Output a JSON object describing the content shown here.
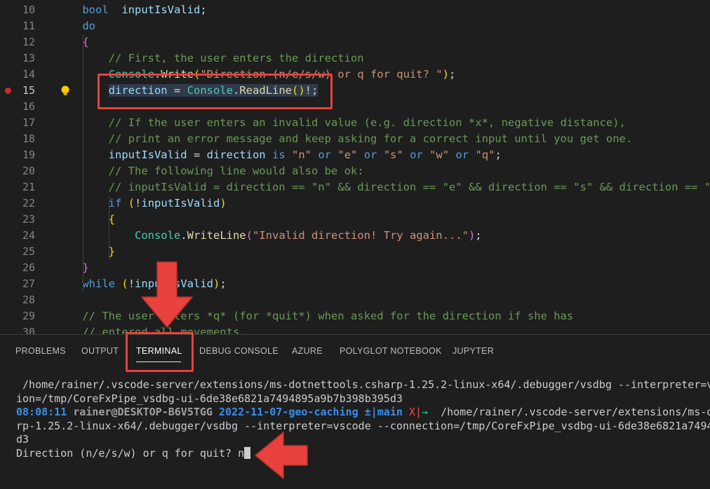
{
  "editor": {
    "lines": [
      {
        "n": "10",
        "parts": [
          [
            "kw",
            "bool"
          ],
          [
            "",
            "  "
          ],
          [
            "var",
            "inputIsValid"
          ],
          [
            "",
            ";"
          ]
        ],
        "indent": "    "
      },
      {
        "n": "11",
        "parts": [
          [
            "kw",
            "do"
          ]
        ],
        "indent": "    "
      },
      {
        "n": "12",
        "parts": [
          [
            "br2",
            "{"
          ]
        ],
        "indent": "    "
      },
      {
        "n": "13",
        "parts": [
          [
            "cmt",
            "// First, the user enters the direction"
          ]
        ],
        "indent": "        "
      },
      {
        "n": "14",
        "parts": [
          [
            "ty",
            "Console"
          ],
          [
            "",
            "."
          ],
          [
            "fn",
            "Write"
          ],
          [
            "br",
            "("
          ],
          [
            "str",
            "\"Direction (n/e/s/w) or q for quit? \""
          ],
          [
            "br",
            ")"
          ],
          [
            "",
            ";"
          ]
        ],
        "indent": "        "
      },
      {
        "n": "15",
        "parts": [
          [
            "var hl",
            "direction"
          ],
          [
            "hl",
            " = "
          ],
          [
            "ty hl",
            "Console"
          ],
          [
            "hl",
            "."
          ],
          [
            "fn hl",
            "ReadLine"
          ],
          [
            "br hl",
            "()"
          ],
          [
            "hl",
            "!;"
          ]
        ],
        "indent": "        "
      },
      {
        "n": "16",
        "parts": [],
        "indent": ""
      },
      {
        "n": "17",
        "parts": [
          [
            "cmt",
            "// If the user enters an invalid value (e.g. direction *x*, negative distance),"
          ]
        ],
        "indent": "        "
      },
      {
        "n": "18",
        "parts": [
          [
            "cmt",
            "// print an error message and keep asking for a correct input until you get one."
          ]
        ],
        "indent": "        "
      },
      {
        "n": "19",
        "parts": [
          [
            "var",
            "inputIsValid"
          ],
          [
            "",
            " = "
          ],
          [
            "var",
            "direction"
          ],
          [
            "",
            " "
          ],
          [
            "kw",
            "is"
          ],
          [
            "",
            " "
          ],
          [
            "str",
            "\"n\""
          ],
          [
            "",
            " "
          ],
          [
            "kw",
            "or"
          ],
          [
            "",
            " "
          ],
          [
            "str",
            "\"e\""
          ],
          [
            "",
            " "
          ],
          [
            "kw",
            "or"
          ],
          [
            "",
            " "
          ],
          [
            "str",
            "\"s\""
          ],
          [
            "",
            " "
          ],
          [
            "kw",
            "or"
          ],
          [
            "",
            " "
          ],
          [
            "str",
            "\"w\""
          ],
          [
            "",
            " "
          ],
          [
            "kw",
            "or"
          ],
          [
            "",
            " "
          ],
          [
            "str",
            "\"q\""
          ],
          [
            "",
            ";"
          ]
        ],
        "indent": "        "
      },
      {
        "n": "20",
        "parts": [
          [
            "cmt",
            "// The following line would also be ok:"
          ]
        ],
        "indent": "        "
      },
      {
        "n": "21",
        "parts": [
          [
            "cmt",
            "// inputIsValid = direction == \"n\" && direction == \"e\" && direction == \"s\" && direction == \"w"
          ]
        ],
        "indent": "        "
      },
      {
        "n": "22",
        "parts": [
          [
            "kw",
            "if"
          ],
          [
            "",
            " "
          ],
          [
            "br",
            "("
          ],
          [
            "",
            "!"
          ],
          [
            "var",
            "inputIsValid"
          ],
          [
            "br",
            ")"
          ]
        ],
        "indent": "        "
      },
      {
        "n": "23",
        "parts": [
          [
            "br",
            "{"
          ]
        ],
        "indent": "        "
      },
      {
        "n": "24",
        "parts": [
          [
            "ty",
            "Console"
          ],
          [
            "",
            "."
          ],
          [
            "fn",
            "WriteLine"
          ],
          [
            "br2",
            "("
          ],
          [
            "str",
            "\"Invalid direction! Try again...\""
          ],
          [
            "br2",
            ")"
          ],
          [
            "",
            ";"
          ]
        ],
        "indent": "            "
      },
      {
        "n": "25",
        "parts": [
          [
            "br",
            "}"
          ]
        ],
        "indent": "        "
      },
      {
        "n": "26",
        "parts": [
          [
            "br2",
            "}"
          ]
        ],
        "indent": "    "
      },
      {
        "n": "27",
        "parts": [
          [
            "kw",
            "while"
          ],
          [
            "",
            " "
          ],
          [
            "br",
            "("
          ],
          [
            "",
            "!"
          ],
          [
            "var",
            "inputIsValid"
          ],
          [
            "br",
            ")"
          ],
          [
            "",
            ";"
          ]
        ],
        "indent": "    "
      },
      {
        "n": "28",
        "parts": [],
        "indent": ""
      },
      {
        "n": "29",
        "parts": [
          [
            "cmt",
            "// The user enters *q* (for *quit*) when asked for the direction if she has"
          ]
        ],
        "indent": "    "
      },
      {
        "n": "30",
        "parts": [
          [
            "cmt",
            "// entered all movements."
          ]
        ],
        "indent": "    "
      }
    ]
  },
  "panel": {
    "tabs": [
      {
        "label": "PROBLEMS",
        "name": "tab-problems"
      },
      {
        "label": "OUTPUT",
        "name": "tab-output"
      },
      {
        "label": "TERMINAL",
        "name": "tab-terminal",
        "active": true
      },
      {
        "label": "DEBUG CONSOLE",
        "name": "tab-debug-console"
      },
      {
        "label": "AZURE",
        "name": "tab-azure"
      },
      {
        "label": "POLYGLOT NOTEBOOK",
        "name": "tab-polyglot-notebook"
      },
      {
        "label": "JUPYTER",
        "name": "tab-jupyter"
      }
    ]
  },
  "terminal": {
    "line1": " /home/rainer/.vscode-server/extensions/ms-dotnettools.csharp-1.25.2-linux-x64/.debugger/vsdbg --interpreter=v",
    "line2": "ion=/tmp/CoreFxPipe_vsdbg-ui-6de38e6821a7494895a9b7b398b395d3",
    "prompt_time": "08:08:11",
    "prompt_user": "rainer@DESKTOP-B6V5TGG",
    "prompt_dir": "2022-11-07-geo-caching",
    "prompt_git": "±|main",
    "prompt_x": "X|",
    "prompt_arrow": "→",
    "prompt_cmd": "  /home/rainer/.vscode-server/extensions/ms-d",
    "line4": "rp-1.25.2-linux-x64/.debugger/vsdbg --interpreter=vscode --connection=/tmp/CoreFxPipe_vsdbg-ui-6de38e6821a7494",
    "line5": "d3",
    "question": "Direction (n/e/s/w) or q for quit? ",
    "typed": "n"
  },
  "colors": {
    "annotation": "#e8413e",
    "breakpoint": "#c72e2e"
  }
}
